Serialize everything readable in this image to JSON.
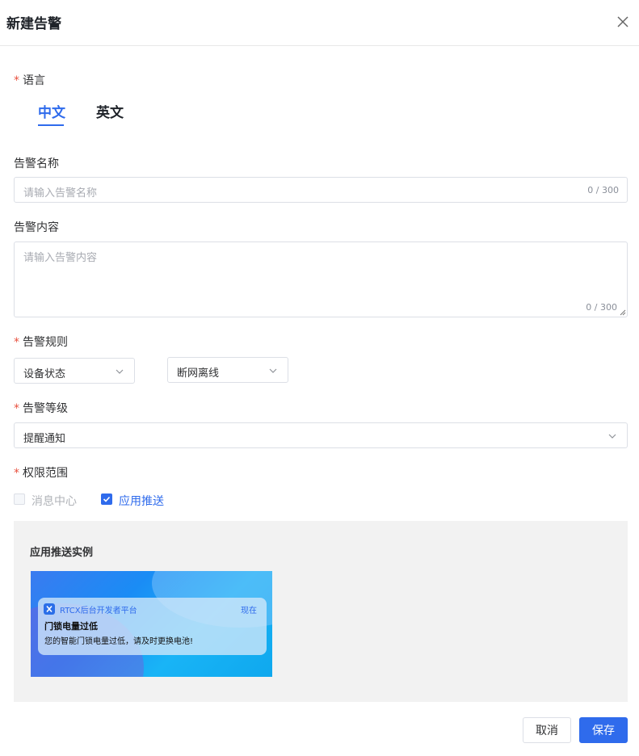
{
  "dialog": {
    "title": "新建告警"
  },
  "language": {
    "label": "语言",
    "tabs": [
      {
        "label": "中文",
        "active": true
      },
      {
        "label": "英文",
        "active": false
      }
    ]
  },
  "alarm_name": {
    "label": "告警名称",
    "placeholder": "请输入告警名称",
    "count": "0 / 300"
  },
  "alarm_content": {
    "label": "告警内容",
    "placeholder": "请输入告警内容",
    "count": "0 / 300"
  },
  "alarm_rule": {
    "label": "告警规则",
    "select1": "设备状态",
    "select2": "断网离线"
  },
  "alarm_level": {
    "label": "告警等级",
    "value": "提醒通知"
  },
  "permission": {
    "label": "权限范围",
    "options": [
      {
        "label": "消息中心",
        "checked": false
      },
      {
        "label": "应用推送",
        "checked": true
      }
    ]
  },
  "preview": {
    "title": "应用推送实例",
    "app_name": "RTCX后台开发者平台",
    "time": "现在",
    "notif_title": "门锁电量过低",
    "notif_body": "您的智能门锁电量过低，请及时更换电池!"
  },
  "footer": {
    "cancel_label": "取消",
    "save_label": "保存"
  },
  "colors": {
    "accent": "#2f6bec",
    "required": "#e8513f"
  }
}
